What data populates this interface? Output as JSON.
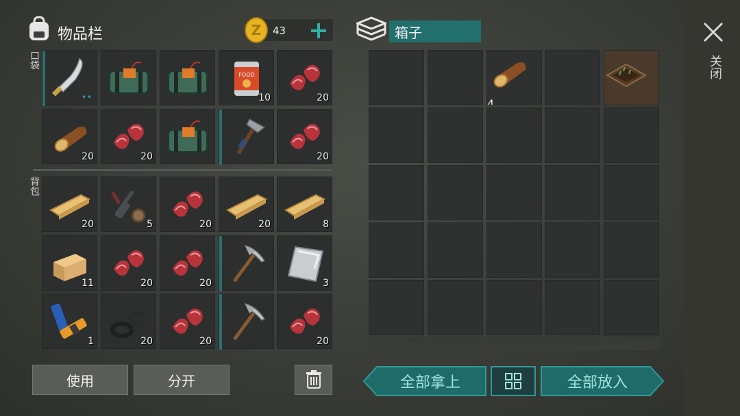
{
  "inventory": {
    "title": "物品栏",
    "coins": "43",
    "pocket_label": "口袋",
    "backpack_label": "背包",
    "pocket": [
      {
        "icon": "machete-icon",
        "count": "",
        "durability": true,
        "dots": "••"
      },
      {
        "icon": "explosive-pack-icon",
        "count": ""
      },
      {
        "icon": "explosive-pack-icon",
        "count": ""
      },
      {
        "icon": "food-can-icon",
        "count": "10"
      },
      {
        "icon": "raw-meat-icon",
        "count": "20"
      },
      {
        "icon": "log-icon",
        "count": "20"
      },
      {
        "icon": "raw-meat-icon",
        "count": "20"
      },
      {
        "icon": "explosive-pack-icon",
        "count": ""
      },
      {
        "icon": "hatchet-icon",
        "count": "",
        "durability": true
      },
      {
        "icon": "raw-meat-icon",
        "count": "20"
      }
    ],
    "backpack": [
      {
        "icon": "plank-icon",
        "count": "20"
      },
      {
        "icon": "gun-parts-icon",
        "count": "5"
      },
      {
        "icon": "raw-meat-icon",
        "count": "20"
      },
      {
        "icon": "plank-icon",
        "count": "20"
      },
      {
        "icon": "plank-icon",
        "count": "8"
      },
      {
        "icon": "wood-block-icon",
        "count": "11"
      },
      {
        "icon": "raw-meat-icon",
        "count": "20"
      },
      {
        "icon": "raw-meat-icon",
        "count": "20"
      },
      {
        "icon": "pickaxe-icon",
        "count": "",
        "durability": true
      },
      {
        "icon": "metal-plate-icon",
        "count": "3"
      },
      {
        "icon": "batteries-icon",
        "count": "1"
      },
      {
        "icon": "rubber-parts-icon",
        "count": "20"
      },
      {
        "icon": "raw-meat-icon",
        "count": "20"
      },
      {
        "icon": "pickaxe-icon",
        "count": "",
        "durability": true
      },
      {
        "icon": "raw-meat-icon",
        "count": "20"
      }
    ],
    "use_label": "使用",
    "split_label": "分开"
  },
  "box": {
    "title": "箱子",
    "items": [
      {
        "icon": "",
        "count": ""
      },
      {
        "icon": "",
        "count": ""
      },
      {
        "icon": "log-icon",
        "count": "4"
      },
      {
        "icon": "",
        "count": ""
      },
      {
        "icon": "garden-bed-icon",
        "count": ""
      }
    ],
    "take_all_label": "全部拿上",
    "put_all_label": "全部放入"
  },
  "close_label": "关闭",
  "colors": {
    "accent": "#2f9a97",
    "coin": "#e6b422",
    "meat": "#b8343a"
  }
}
